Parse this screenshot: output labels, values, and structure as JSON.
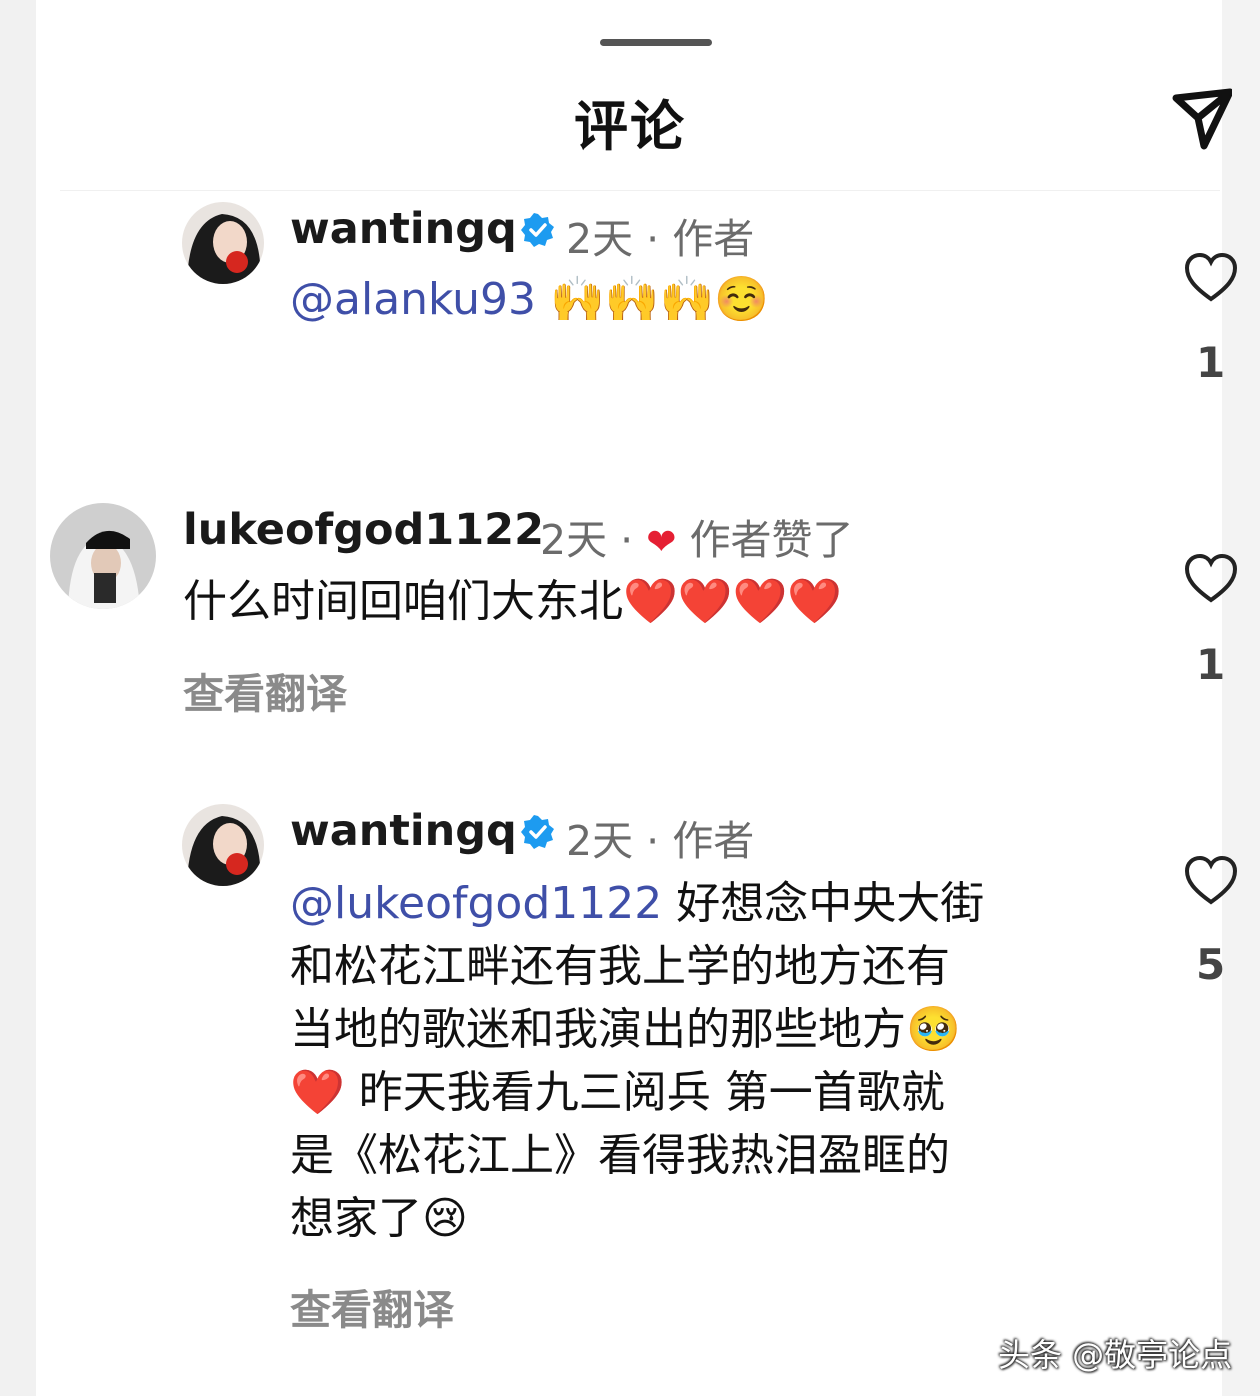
{
  "header": {
    "title": "评论"
  },
  "comments": [
    {
      "username": "wantingq",
      "verified": true,
      "time": "2天",
      "sep": "·",
      "tag": "作者",
      "mention": "@alanku93",
      "text": "",
      "emojis": "🙌🙌🙌☺️",
      "like_count": "1"
    },
    {
      "username": "lukeofgod1122",
      "verified": false,
      "time": "2天",
      "sep": "·",
      "liked_by_author_heart": "❤",
      "tag": "作者赞了",
      "text": "什么时间回咱们大东北",
      "emojis": "❤️❤️❤️❤️",
      "translate": "查看翻译",
      "like_count": "1"
    },
    {
      "username": "wantingq",
      "verified": true,
      "time": "2天",
      "sep": "·",
      "tag": "作者",
      "mention": "@lukeofgod1122",
      "lines": [
        " 好想念中央大街",
        "和松花江畔还有我上学的地方还有",
        "当地的歌迷和我演出的那些地方🥹",
        "❤️ 昨天我看九三阅兵 第一首歌就",
        "是《松花江上》看得我热泪盈眶的",
        "想家了😢"
      ],
      "translate": "查看翻译",
      "like_count": "5"
    }
  ],
  "watermark": "头条 @敬亭论点",
  "colors": {
    "mention": "#3f4fa8",
    "verified": "#1d9bf0",
    "heart": "#e51f33",
    "meta": "#6b6b6b"
  }
}
